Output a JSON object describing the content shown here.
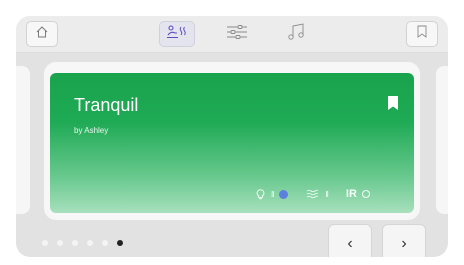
{
  "toolbar": {
    "home_icon": "home-icon",
    "tabs": [
      {
        "id": "scene",
        "icon": "person-steam-icon",
        "active": true
      },
      {
        "id": "settings",
        "icon": "sliders-icon",
        "active": false
      },
      {
        "id": "music",
        "icon": "music-note-icon",
        "active": false
      }
    ],
    "bookmark_icon": "bookmark-outline-icon"
  },
  "card": {
    "title": "Tranquil",
    "author": "by Ashley",
    "bookmarked": true,
    "indicators": {
      "light_bars": "II",
      "heat_bars": "II",
      "ir_label": "IR",
      "ir_on": false
    }
  },
  "pager": {
    "count": 6,
    "active_index": 5
  },
  "nav": {
    "prev_label": "‹",
    "next_label": "›"
  },
  "colors": {
    "card_green": "#19a34c",
    "active_dot_blue": "#5d7fe0"
  }
}
